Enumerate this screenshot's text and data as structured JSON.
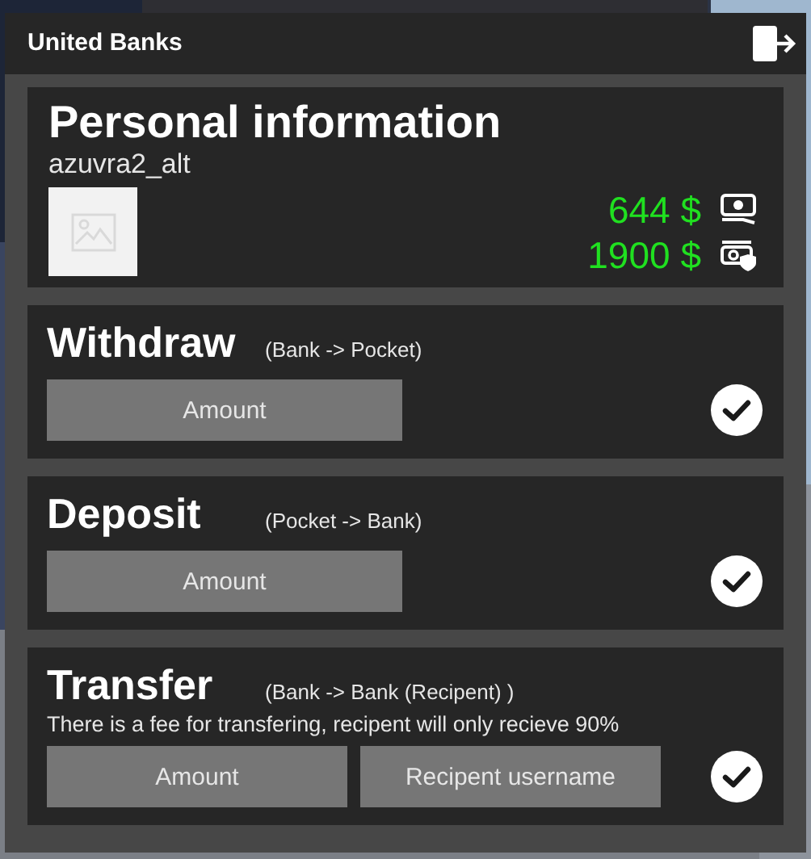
{
  "window": {
    "title": "United Banks"
  },
  "profile": {
    "title": "Personal information",
    "username": "azuvra2_alt",
    "balances": [
      {
        "kind": "cash",
        "amount": "644 $"
      },
      {
        "kind": "bank",
        "amount": "1900 $"
      }
    ]
  },
  "sections": [
    {
      "title": "Withdraw",
      "subtitle": "(Bank -> Pocket)",
      "fields": [
        {
          "placeholder": "Amount"
        }
      ]
    },
    {
      "title": "Deposit",
      "subtitle": "(Pocket -> Bank)",
      "fields": [
        {
          "placeholder": "Amount"
        }
      ]
    },
    {
      "title": "Transfer",
      "subtitle": "(Bank -> Bank (Recipent) )",
      "note": "There is a fee for transfering, recipent will only recieve 90%",
      "fields": [
        {
          "placeholder": "Amount"
        },
        {
          "placeholder": "Recipent username"
        }
      ]
    }
  ]
}
